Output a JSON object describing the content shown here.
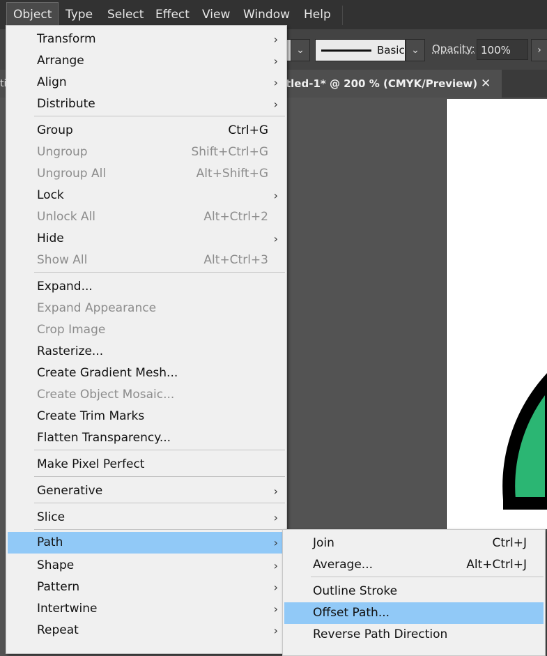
{
  "menubar": {
    "items": [
      "Object",
      "Type",
      "Select",
      "Effect",
      "View",
      "Window",
      "Help"
    ]
  },
  "control_bar": {
    "stroke_style": "Basic",
    "opacity_label": "Opacity:",
    "opacity_value": "100%"
  },
  "document_tab": {
    "title": "tled-1* @ 200 % (CMYK/Preview)",
    "close": "✕",
    "left_stub": "ti"
  },
  "object_menu": {
    "items": {
      "transform": "Transform",
      "arrange": "Arrange",
      "align": "Align",
      "distribute": "Distribute",
      "group": "Group",
      "group_sc": "Ctrl+G",
      "ungroup": "Ungroup",
      "ungroup_sc": "Shift+Ctrl+G",
      "ungroup_all": "Ungroup All",
      "ungroup_all_sc": "Alt+Shift+G",
      "lock": "Lock",
      "unlock_all": "Unlock All",
      "unlock_all_sc": "Alt+Ctrl+2",
      "hide": "Hide",
      "show_all": "Show All",
      "show_all_sc": "Alt+Ctrl+3",
      "expand": "Expand...",
      "expand_appearance": "Expand Appearance",
      "crop_image": "Crop Image",
      "rasterize": "Rasterize...",
      "gradient_mesh": "Create Gradient Mesh...",
      "object_mosaic": "Create Object Mosaic...",
      "trim_marks": "Create Trim Marks",
      "flatten_transparency": "Flatten Transparency...",
      "pixel_perfect": "Make Pixel Perfect",
      "generative": "Generative",
      "slice": "Slice",
      "path": "Path",
      "shape": "Shape",
      "pattern": "Pattern",
      "intertwine": "Intertwine",
      "repeat": "Repeat"
    }
  },
  "path_submenu": {
    "join": "Join",
    "join_sc": "Ctrl+J",
    "average": "Average...",
    "average_sc": "Alt+Ctrl+J",
    "outline_stroke": "Outline Stroke",
    "offset_path": "Offset Path...",
    "reverse_path": "Reverse Path Direction"
  },
  "colors": {
    "highlight": "#91c9f7",
    "shape_fill": "#2bb673",
    "shape_stroke": "#000000"
  }
}
